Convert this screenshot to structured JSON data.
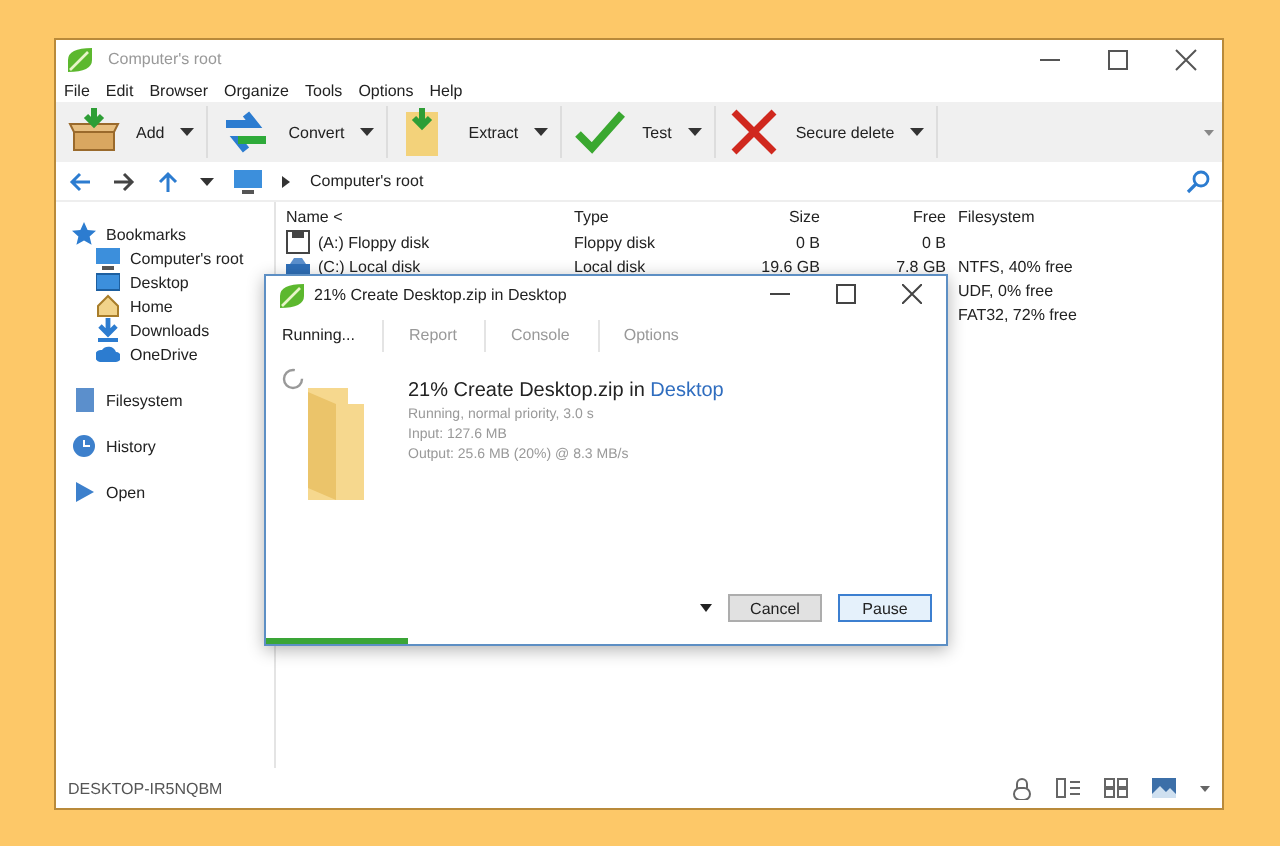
{
  "window": {
    "title": "Computer's root"
  },
  "menu": [
    "File",
    "Edit",
    "Browser",
    "Organize",
    "Tools",
    "Options",
    "Help"
  ],
  "toolbar": [
    {
      "kind": "add",
      "label": "Add"
    },
    {
      "kind": "convert",
      "label": "Convert"
    },
    {
      "kind": "extract",
      "label": "Extract"
    },
    {
      "kind": "test",
      "label": "Test"
    },
    {
      "kind": "delete",
      "label": "Secure delete"
    }
  ],
  "address": {
    "path": "Computer's root"
  },
  "sidebar": {
    "items": [
      {
        "kind": "star",
        "label": "Bookmarks",
        "children": [
          {
            "kind": "computer",
            "label": "Computer's root"
          },
          {
            "kind": "desktop",
            "label": "Desktop"
          },
          {
            "kind": "home",
            "label": "Home"
          },
          {
            "kind": "download",
            "label": "Downloads"
          },
          {
            "kind": "cloud",
            "label": "OneDrive"
          }
        ]
      },
      {
        "kind": "filesystem",
        "label": "Filesystem"
      },
      {
        "kind": "history",
        "label": "History"
      },
      {
        "kind": "open",
        "label": "Open"
      }
    ]
  },
  "table": {
    "columns": [
      "Name <",
      "Type",
      "Size",
      "Free",
      "Filesystem"
    ],
    "rows": [
      {
        "kind": "floppy",
        "name": "(A:) Floppy disk",
        "type": "Floppy disk",
        "size": "0 B",
        "free": "0 B",
        "filesystem": ""
      },
      {
        "kind": "disk",
        "name": "(C:) Local disk",
        "type": "Local disk",
        "size": "19.6 GB",
        "free": "7.8 GB",
        "filesystem": "NTFS, 40% free"
      },
      {
        "kind": "hidden",
        "filesystem": "UDF, 0% free"
      },
      {
        "kind": "hidden",
        "filesystem": "FAT32, 72% free"
      }
    ]
  },
  "dialog": {
    "title": "21% Create Desktop.zip in Desktop",
    "tabs": [
      {
        "label": "Running...",
        "selected": true
      },
      {
        "label": "Report",
        "selected": false
      },
      {
        "label": "Console",
        "selected": false
      },
      {
        "label": "Options",
        "selected": false
      }
    ],
    "heading": "21% Create Desktop.zip in ",
    "heading_link": "Desktop",
    "details": [
      "Running, normal priority, 3.0 s",
      "Input: 127.6 MB",
      "Output: 25.6 MB (20%) @ 8.3 MB/s"
    ],
    "buttons": [
      {
        "label": "Cancel",
        "selected": false
      },
      {
        "label": "Pause",
        "selected": true
      }
    ],
    "progress": {
      "level": 0.21
    }
  },
  "status_bar": {
    "text": "DESKTOP-IR5NQBM"
  }
}
